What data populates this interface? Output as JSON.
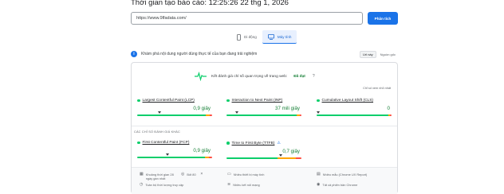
{
  "header": {
    "report_time": "Thời gian tạo báo cáo: 12:25:26 22 thg 1, 2026"
  },
  "search": {
    "url_value": "https://www.9lfadata.com/",
    "analyze_label": "Phân tích"
  },
  "device_tabs": [
    {
      "label": "Di động",
      "icon": "phone-icon",
      "active": false
    },
    {
      "label": "Máy tính",
      "icon": "desktop-icon",
      "active": true
    }
  ],
  "section": {
    "description": "Khám phá nội dung người dùng thực tế của bạn đang trải nghiệm",
    "tab_this_url": "Url này",
    "tab_origin": "Nguồn gốc"
  },
  "assessment": {
    "text": "Kết đánh giá chỉ số quan trọng về trang web:",
    "result": "Đã đạt",
    "help": "?"
  },
  "see_more": "Chỉ số xem nhỏ nhất",
  "core_metrics": [
    {
      "name": "Largest Contentful Paint (LCP)",
      "value": "0,9 giây",
      "good_pct": 92,
      "ni_pct": 5,
      "poor_pct": 3,
      "marker_pct": 30,
      "flag": true
    },
    {
      "name": "Interaction to Next Paint (INP)",
      "value": "37 mili giây",
      "good_pct": 94,
      "ni_pct": 4,
      "poor_pct": 2,
      "marker_pct": 14,
      "flag": true
    },
    {
      "name": "Cumulative Layout Shift (CLS)",
      "value": "0",
      "good_pct": 96,
      "ni_pct": 2,
      "poor_pct": 2,
      "marker_pct": 2,
      "flag": true
    }
  ],
  "other_label": "CÁC CHỈ SỐ ĐÁNH GIÁ KHÁC",
  "other_metrics": [
    {
      "name": "First Contentful Paint (FCP)",
      "value": "0,9 giây",
      "good_pct": 90,
      "ni_pct": 6,
      "poor_pct": 4,
      "marker_pct": 40,
      "flag": false
    },
    {
      "name": "Time to First Byte (TTFB)",
      "value": "0,7 giây",
      "good_pct": 68,
      "ni_pct": 25,
      "poor_pct": 7,
      "marker_pct": 72,
      "flag": true
    }
  ],
  "footer": {
    "items": [
      {
        "icon": "calendar-icon",
        "text": "Khoảng thời gian 28 ngày gần nhất"
      },
      {
        "icon": "devices-icon",
        "text": "Nhiều thiết bị máy tính"
      },
      {
        "icon": "ruler-icon",
        "text": "Nhiều mẫu (Chrome UX Report)",
        "link": "Chrome UX Report"
      },
      {
        "icon": "clock-icon",
        "text": "Toàn bộ thời lượng truy cập"
      },
      {
        "icon": "wifi-icon",
        "text": "Nhiều kết nối mạng"
      },
      {
        "icon": "chrome-icon",
        "text": "Tất cả phiên bản Chrome"
      }
    ],
    "extra_label": "Bốt 80"
  },
  "colors": {
    "accent": "#1a73e8",
    "good": "#0cce6b",
    "needs_improvement": "#ffa400",
    "poor": "#ff4e42",
    "pass_text": "#188038"
  }
}
